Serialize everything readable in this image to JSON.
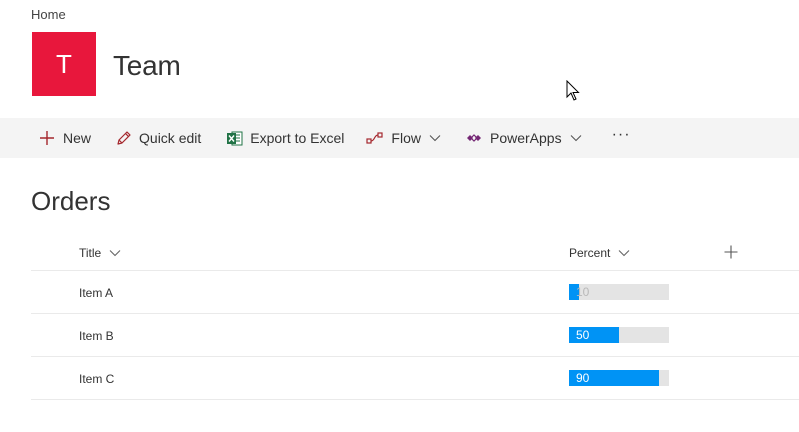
{
  "breadcrumb": "Home",
  "site": {
    "logo_letter": "T",
    "title": "Team",
    "logo_color": "#e8173c"
  },
  "command_bar": {
    "new": "New",
    "quick_edit": "Quick edit",
    "export": "Export to Excel",
    "flow": "Flow",
    "powerapps": "PowerApps",
    "more": "···"
  },
  "list": {
    "title": "Orders",
    "columns": {
      "title": "Title",
      "percent": "Percent"
    },
    "rows": [
      {
        "title": "Item A",
        "percent": 10
      },
      {
        "title": "Item B",
        "percent": 50
      },
      {
        "title": "Item C",
        "percent": 90
      }
    ]
  },
  "colors": {
    "accent": "#a4262c",
    "bar_fill": "#0093f5",
    "bar_track": "#e4e4e4",
    "excel": "#217346",
    "powerapps": "#742774"
  },
  "icons": {
    "add": "plus-icon",
    "edit": "pencil-icon",
    "excel": "excel-icon",
    "flow": "flow-icon",
    "powerapps": "powerapps-icon",
    "sort": "chevron-down-icon",
    "add_column": "plus-icon",
    "pointer": "mouse-pointer-icon"
  }
}
